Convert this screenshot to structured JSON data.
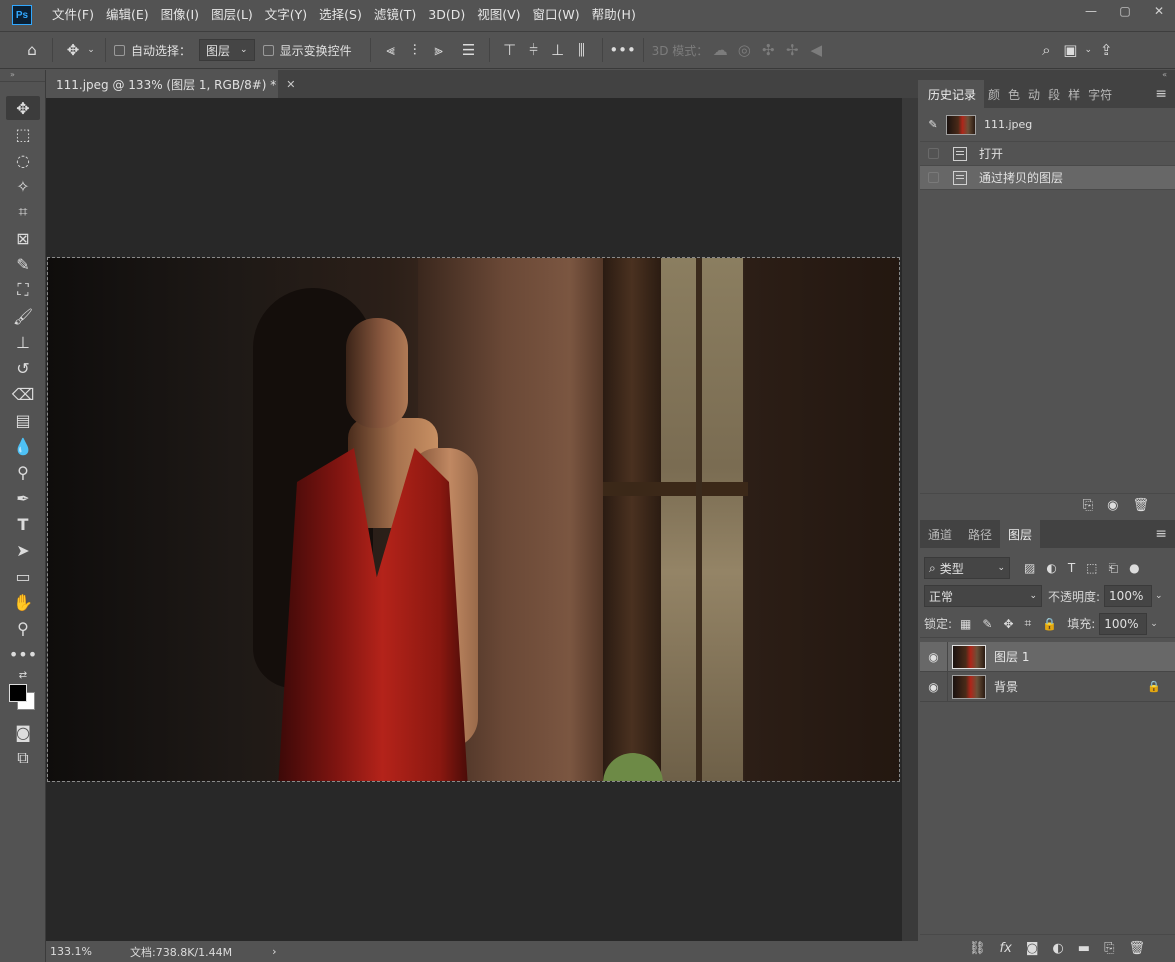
{
  "app": {
    "logo": "Ps"
  },
  "menu": [
    "文件(F)",
    "编辑(E)",
    "图像(I)",
    "图层(L)",
    "文字(Y)",
    "选择(S)",
    "滤镜(T)",
    "3D(D)",
    "视图(V)",
    "窗口(W)",
    "帮助(H)"
  ],
  "options": {
    "auto_select_label": "自动选择：",
    "auto_select_value": "图层",
    "show_transform_label": "显示变换控件",
    "mode_3d_label": "3D 模式："
  },
  "document": {
    "tab_title": "111.jpeg @ 133% (图层 1, RGB/8#) *",
    "zoom": "133.1%",
    "doc_info": "文档:738.8K/1.44M"
  },
  "history_panel": {
    "tabs": [
      "历史记录",
      "颜",
      "色",
      "动",
      "段",
      "样",
      "字符"
    ],
    "snapshot_label": "111.jpeg",
    "items": [
      "打开",
      "通过拷贝的图层"
    ]
  },
  "layers_panel": {
    "tabs": [
      "通道",
      "路径",
      "图层"
    ],
    "filter_kind": "类型",
    "blend_mode": "正常",
    "opacity_label": "不透明度:",
    "opacity_value": "100%",
    "lock_label": "锁定:",
    "fill_label": "填充:",
    "fill_value": "100%",
    "layers": [
      {
        "name": "图层 1",
        "selected": true,
        "locked": false
      },
      {
        "name": "背景",
        "selected": false,
        "locked": true
      }
    ]
  },
  "colors": {
    "ui_bg": "#535353",
    "canvas_bg": "#282828",
    "selected_row": "#686868",
    "ps_blue": "#31a8ff"
  }
}
